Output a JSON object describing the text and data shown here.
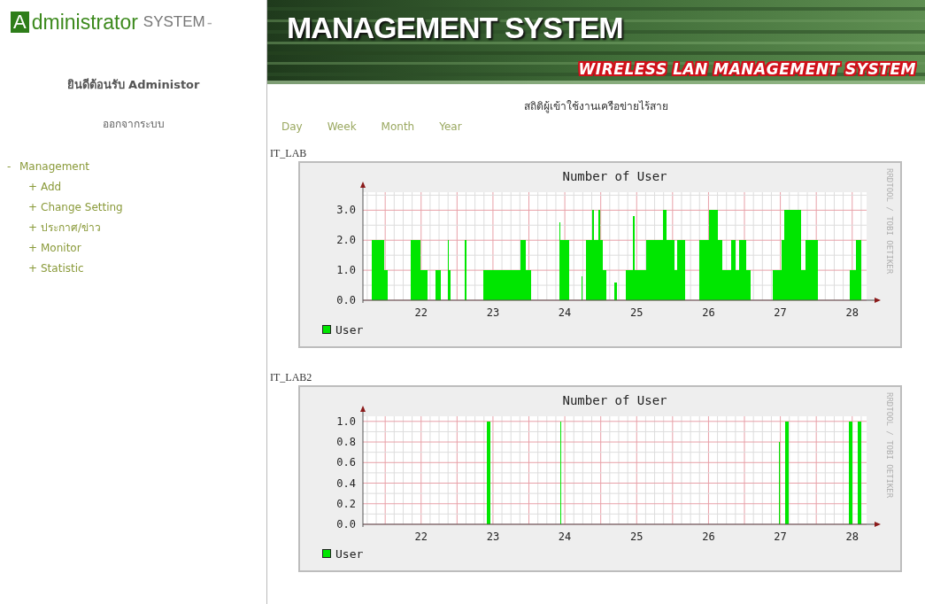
{
  "logo": {
    "initial": "A",
    "word": "dministrator",
    "suffix": "SYSTEM",
    "dash": "-"
  },
  "banner": {
    "title": "MANAGEMENT SYSTEM",
    "subtitle": "WIRELESS LAN MANAGEMENT SYSTEM"
  },
  "sidebar": {
    "welcome": "ยินดีต้อนรับ Administor",
    "logout": "ออกจากระบบ",
    "menu": [
      {
        "marker": "-",
        "label": "Management",
        "children": [
          {
            "marker": "+",
            "label": "Add"
          },
          {
            "marker": "+",
            "label": "Change Setting"
          },
          {
            "marker": "+",
            "label": "ประกาศ/ข่าว"
          },
          {
            "marker": "+",
            "label": "Monitor"
          },
          {
            "marker": "+",
            "label": "Statistic"
          }
        ]
      }
    ]
  },
  "page_title": "สถิติผู้เข้าใช้งานเครือข่ายไร้สาย",
  "tabs": [
    {
      "label": "Day",
      "selected": false
    },
    {
      "label": "Week",
      "selected": false
    },
    {
      "label": "Month",
      "selected": false
    },
    {
      "label": "Year",
      "selected": false
    }
  ],
  "graphs": [
    {
      "label": "IT_LAB",
      "credit": "RRDTOOL / TOBI OETIKER",
      "chart_data": {
        "type": "area",
        "grid": true,
        "title": "Number of User",
        "x": [
          21.31,
          21.31,
          21.49,
          21.49,
          21.53,
          21.53,
          21.85,
          21.85,
          21.99,
          21.99,
          22.09,
          22.09,
          22.2,
          22.2,
          22.27,
          22.27,
          22.37,
          22.37,
          22.39,
          22.39,
          22.41,
          22.41,
          22.61,
          22.61,
          22.63,
          22.63,
          22.87,
          22.87,
          23.38,
          23.38,
          23.46,
          23.46,
          23.53,
          23.53,
          23.92,
          23.92,
          23.94,
          23.94,
          24.06,
          24.06,
          24.23,
          24.23,
          24.25,
          24.25,
          24.3,
          24.3,
          24.38,
          24.38,
          24.4,
          24.4,
          24.45,
          24.45,
          24.46,
          24.46,
          24.47,
          24.47,
          24.49,
          24.49,
          24.53,
          24.53,
          24.58,
          24.58,
          24.69,
          24.69,
          24.72,
          24.72,
          24.85,
          24.85,
          24.95,
          24.95,
          24.97,
          24.97,
          25.13,
          25.13,
          25.37,
          25.37,
          25.42,
          25.42,
          25.53,
          25.53,
          25.56,
          25.56,
          25.67,
          25.67,
          25.68,
          25.68,
          25.87,
          25.87,
          26.01,
          26.01,
          26.13,
          26.13,
          26.19,
          26.19,
          26.31,
          26.31,
          26.38,
          26.38,
          26.42,
          26.42,
          26.53,
          26.53,
          26.59,
          26.59,
          26.89,
          26.89,
          27.02,
          27.02,
          27.06,
          27.06,
          27.29,
          27.29,
          27.35,
          27.35,
          27.52,
          27.52,
          27.97,
          27.97,
          28.05,
          28.05,
          28.12,
          28.12
        ],
        "series": [
          {
            "name": "User",
            "color": "#00e600",
            "values": [
              0,
              2,
              2,
              1,
              1,
              0,
              0,
              2,
              2,
              1,
              1,
              0,
              0,
              1,
              1,
              0,
              0,
              2,
              2,
              1,
              1,
              0,
              0,
              2,
              2,
              0,
              0,
              1,
              1,
              2,
              2,
              1,
              1,
              0,
              0,
              2.6,
              2.6,
              2,
              2,
              0,
              0,
              0.8,
              0.8,
              0,
              0,
              2,
              2,
              3,
              3,
              2,
              2,
              2.6,
              2.6,
              2,
              2,
              3,
              3,
              2,
              2,
              1,
              1,
              0,
              0,
              0.6,
              0.6,
              0,
              0,
              1,
              1,
              2.8,
              2.8,
              1,
              1,
              2,
              2,
              3,
              3,
              2,
              2,
              1,
              1,
              2,
              2,
              1,
              1,
              0,
              0,
              2,
              2,
              3,
              3,
              2,
              2,
              1,
              1,
              2,
              2,
              1,
              1,
              2,
              2,
              1,
              1,
              0,
              0,
              1,
              1,
              2,
              2,
              3,
              3,
              1,
              1,
              2,
              2,
              0,
              0,
              1,
              1,
              2,
              2,
              0
            ]
          }
        ],
        "xlim": [
          21.19,
          28.2
        ],
        "ylim": [
          0,
          3.6
        ],
        "xticks": [
          22,
          23,
          24,
          25,
          26,
          27,
          28
        ],
        "yticks": [
          {
            "value": 0,
            "label": "0.0"
          },
          {
            "value": 1,
            "label": "1.0"
          },
          {
            "value": 2,
            "label": "2.0"
          },
          {
            "value": 3,
            "label": "3.0"
          }
        ]
      }
    },
    {
      "label": "IT_LAB2",
      "credit": "RRDTOOL / TOBI OETIKER",
      "chart_data": {
        "type": "area",
        "grid": true,
        "title": "Number of User",
        "x": [
          22.92,
          22.92,
          22.97,
          22.97,
          23.94,
          23.94,
          23.95,
          23.95,
          26.98,
          26.98,
          26.99,
          26.99,
          27.07,
          27.07,
          27.11,
          27.11,
          27.95,
          27.95,
          28.0,
          28.0,
          28.08,
          28.08,
          28.12,
          28.12
        ],
        "series": [
          {
            "name": "User",
            "color": "#00e600",
            "values": [
              0,
              1,
              1,
              0,
              0,
              1,
              1,
              0,
              0,
              0.8,
              0.8,
              0,
              0,
              1,
              1,
              0,
              0,
              1,
              1,
              0,
              0,
              1,
              1,
              0
            ]
          }
        ],
        "xlim": [
          21.19,
          28.2
        ],
        "ylim": [
          0,
          1.05
        ],
        "xticks": [
          22,
          23,
          24,
          25,
          26,
          27,
          28
        ],
        "yticks": [
          {
            "value": 0,
            "label": "0.0"
          },
          {
            "value": 0.2,
            "label": "0.2"
          },
          {
            "value": 0.4,
            "label": "0.4"
          },
          {
            "value": 0.6,
            "label": "0.6"
          },
          {
            "value": 0.8,
            "label": "0.8"
          },
          {
            "value": 1,
            "label": "1.0"
          }
        ]
      }
    }
  ]
}
